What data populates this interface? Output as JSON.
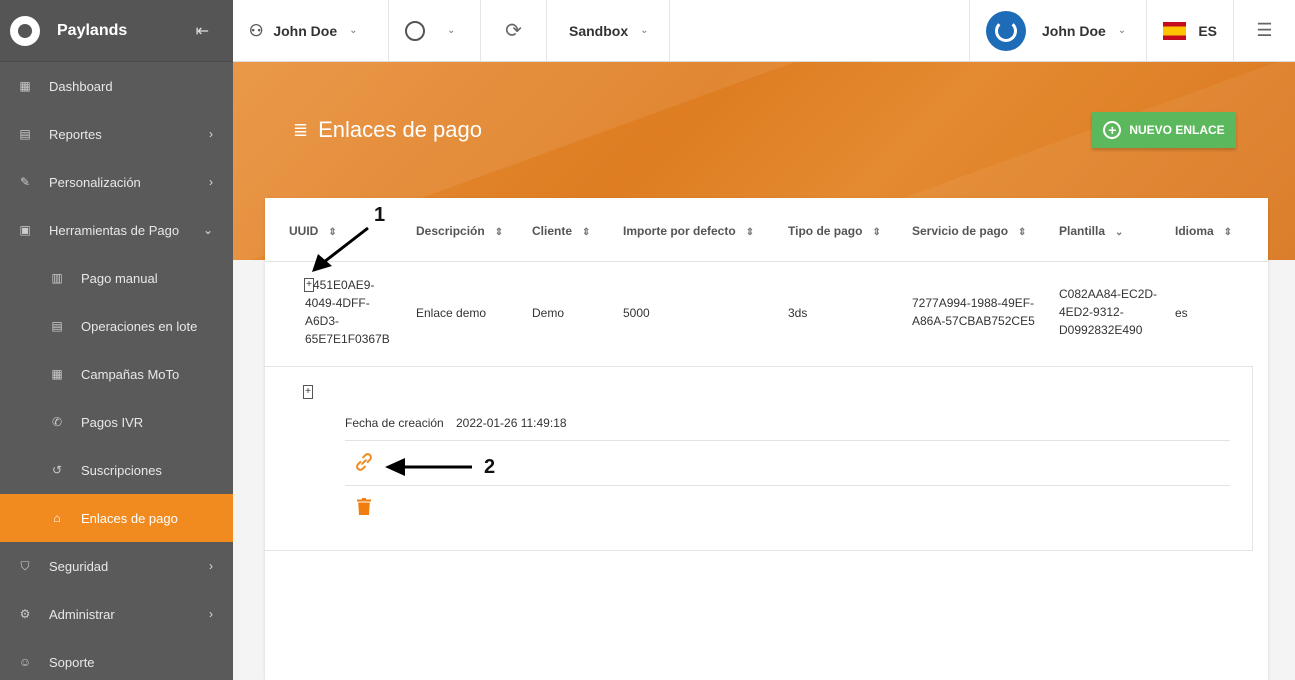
{
  "brand": {
    "name": "Paylands"
  },
  "sidebar": {
    "items": [
      {
        "label": "Dashboard",
        "icon": "dashboard-icon"
      },
      {
        "label": "Reportes",
        "icon": "report-icon"
      },
      {
        "label": "Personalización",
        "icon": "brush-icon"
      },
      {
        "label": "Herramientas de Pago",
        "icon": "payment-tools-icon"
      },
      {
        "label": "Pago manual",
        "icon": "manual-payment-icon"
      },
      {
        "label": "Operaciones en lote",
        "icon": "batch-icon"
      },
      {
        "label": "Campañas MoTo",
        "icon": "calendar-icon"
      },
      {
        "label": "Pagos IVR",
        "icon": "phone-icon"
      },
      {
        "label": "Suscripciones",
        "icon": "history-icon"
      },
      {
        "label": "Enlaces de pago",
        "icon": "bank-icon"
      },
      {
        "label": "Seguridad",
        "icon": "shield-icon"
      },
      {
        "label": "Administrar",
        "icon": "gear-icon"
      },
      {
        "label": "Soporte",
        "icon": "support-icon"
      }
    ]
  },
  "topbar": {
    "account": "John Doe",
    "environment": "Sandbox",
    "user": "John Doe",
    "language": "ES"
  },
  "page": {
    "title": "Enlaces de pago",
    "new_button": "NUEVO ENLACE"
  },
  "table": {
    "columns": [
      "UUID",
      "Descripción",
      "Cliente",
      "Importe por defecto",
      "Tipo de pago",
      "Servicio de pago",
      "Plantilla",
      "Idioma"
    ],
    "row": {
      "uuid": "451E0AE9-\n4049-4DFF-\nA6D3-\n65E7E1F0367B",
      "uuid_lines": [
        "451E0AE9-",
        "4049-4DFF-",
        "A6D3-",
        "65E7E1F0367B"
      ],
      "descripcion": "Enlace demo",
      "cliente": "Demo",
      "importe": "5000",
      "tipo_pago": "3ds",
      "servicio_lines": [
        "7277A994-1988-49EF-",
        "A86A-57CBAB752CE5"
      ],
      "plantilla_lines": [
        "C082AA84-EC2D-",
        "4ED2-9312-",
        "D0992832E490"
      ],
      "idioma": "es"
    },
    "detail": {
      "label": "Fecha de creación",
      "value": "2022-01-26 11:49:18"
    }
  },
  "annotations": {
    "one": "1",
    "two": "2"
  },
  "colors": {
    "accent": "#f18b1f",
    "sidebar": "#5a5a5a",
    "success": "#5cb85c",
    "avatar": "#1e6bb8"
  }
}
